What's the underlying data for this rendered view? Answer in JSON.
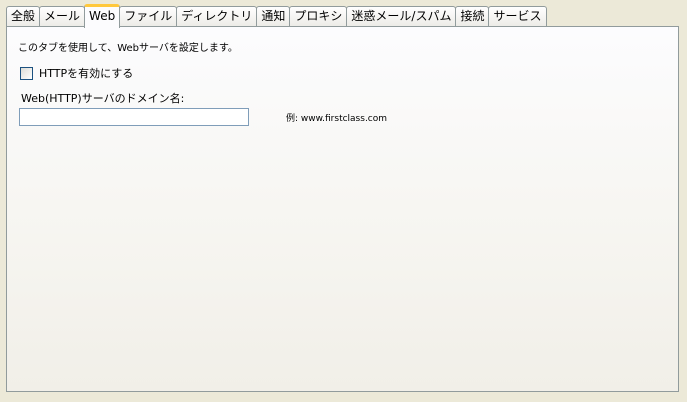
{
  "tabs": [
    {
      "label": "全般",
      "active": false
    },
    {
      "label": "メール",
      "active": false
    },
    {
      "label": "Web",
      "active": true
    },
    {
      "label": "ファイル",
      "active": false
    },
    {
      "label": "ディレクトリ",
      "active": false
    },
    {
      "label": "通知",
      "active": false
    },
    {
      "label": "プロキシ",
      "active": false
    },
    {
      "label": "迷惑メール/スパム",
      "active": false
    },
    {
      "label": "接続",
      "active": false
    },
    {
      "label": "サービス",
      "active": false
    }
  ],
  "web": {
    "description": "このタブを使用して、Webサーバを設定します。",
    "enable_http_label": "HTTPを有効にする",
    "enable_http_checked": false,
    "domain_label": "Web(HTTP)サーバのドメイン名:",
    "domain_value": "",
    "example": "例: www.firstclass.com"
  }
}
